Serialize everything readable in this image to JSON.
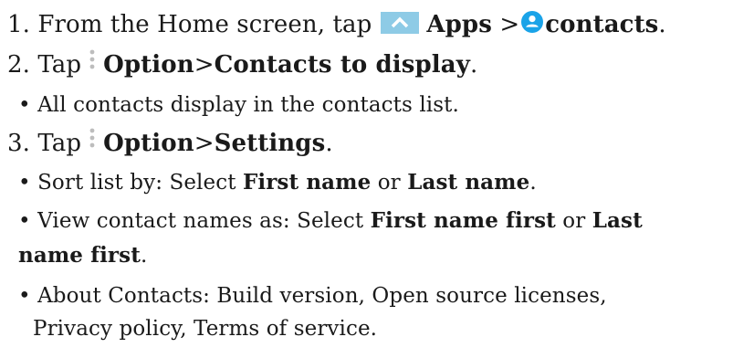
{
  "step1": {
    "prefix": "1. From the Home screen, tap",
    "apps_label": "Apps",
    "separator": " >",
    "contacts_label": "contacts",
    "end": "."
  },
  "step2": {
    "prefix": "2. Tap",
    "option_label": "Option",
    "separator": ">",
    "target_label": "Contacts to display",
    "end": "."
  },
  "step2_bullet": "• All contacts display in the contacts list.",
  "step3": {
    "prefix": "3. Tap",
    "option_label": "Option",
    "separator": ">",
    "target_label": "Settings",
    "end": "."
  },
  "sort_bullet": {
    "prefix": "• Sort list by: Select ",
    "first": "First name",
    "or": " or ",
    "last": "Last name",
    "end": "."
  },
  "view_bullet": {
    "prefix": "• View contact names as: Select ",
    "first": "First name first",
    "or": " or ",
    "last_part1": "Last",
    "last_part2": "name first",
    "end": "."
  },
  "about_bullet": {
    "line1": "• About Contacts: Build version, Open source licenses,",
    "line2": "Privacy policy, Terms of service."
  },
  "icons": {
    "apps": "chevron-up-icon",
    "contacts": "contacts-icon",
    "options": "more-vertical-icon"
  },
  "colors": {
    "apps_tile": "#8ecbe6",
    "contacts_circle": "#1aa3e8",
    "options_dots": "#bdbdbd"
  }
}
